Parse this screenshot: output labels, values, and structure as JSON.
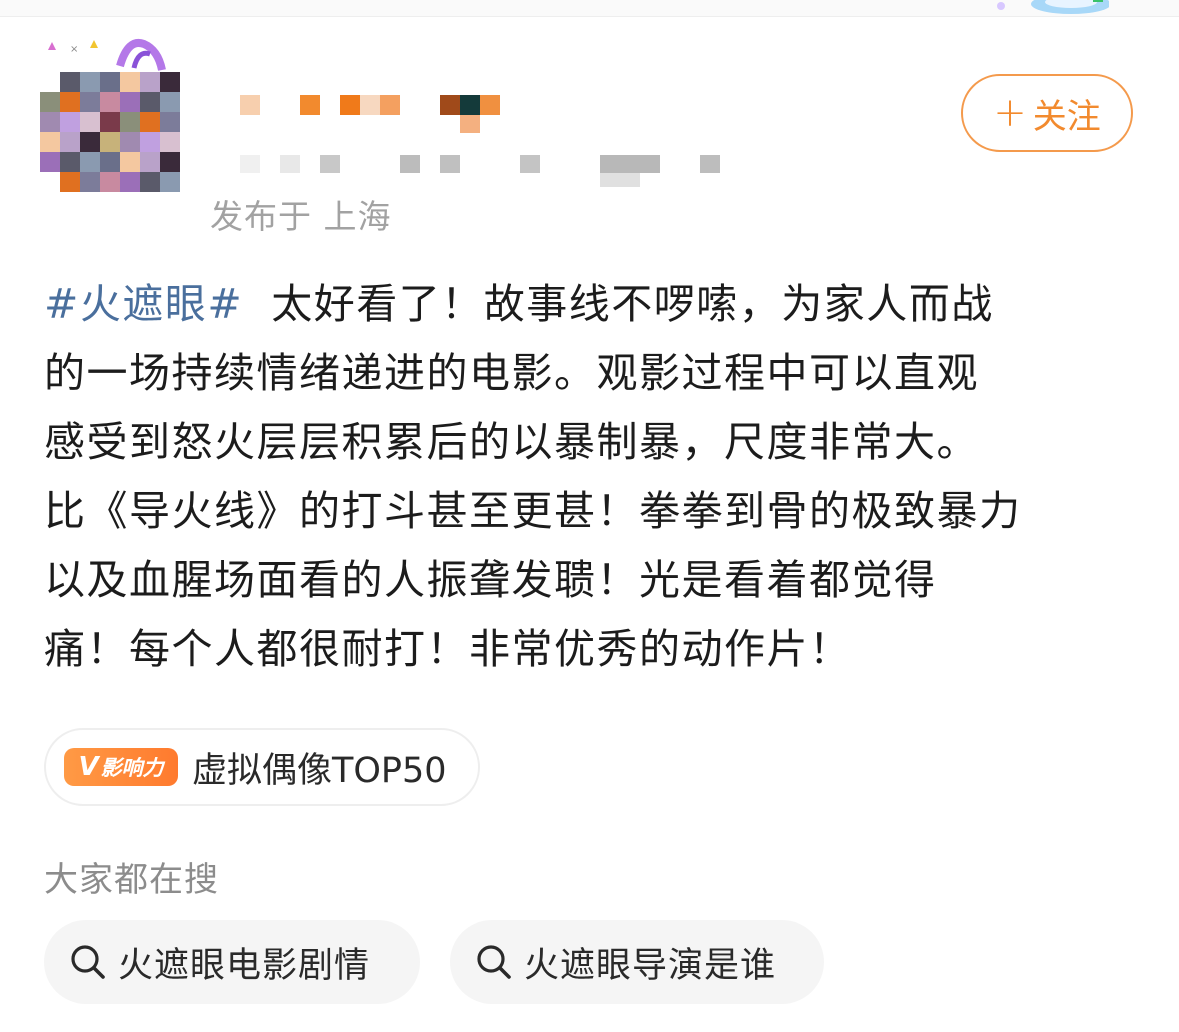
{
  "post": {
    "location": "发布于 上海",
    "follow_label": "关注",
    "hashtag": "#火遮眼#",
    "lines": [
      "太好看了！故事线不啰嗦，为家人而战",
      "的一场持续情绪递进的电影。观影过程中可以直观",
      "感受到怒火层层积累后的以暴制暴，尺度非常大。",
      "比《导火线》的打斗甚至更甚！拳拳到骨的极致暴力",
      "以及血腥场面看的人振聋发聩！光是看着都觉得",
      "痛！每个人都很耐打！非常优秀的动作片！"
    ]
  },
  "influence": {
    "badge_v": "V",
    "badge_text": "影响力",
    "label": "虚拟偶像TOP50"
  },
  "search": {
    "heading": "大家都在搜",
    "chips": [
      "火遮眼电影剧情",
      "火遮眼导演是谁"
    ]
  },
  "colors": {
    "accent": "#f28a2e",
    "hashtag": "#4a6f9d",
    "muted": "#a2a2a2"
  }
}
